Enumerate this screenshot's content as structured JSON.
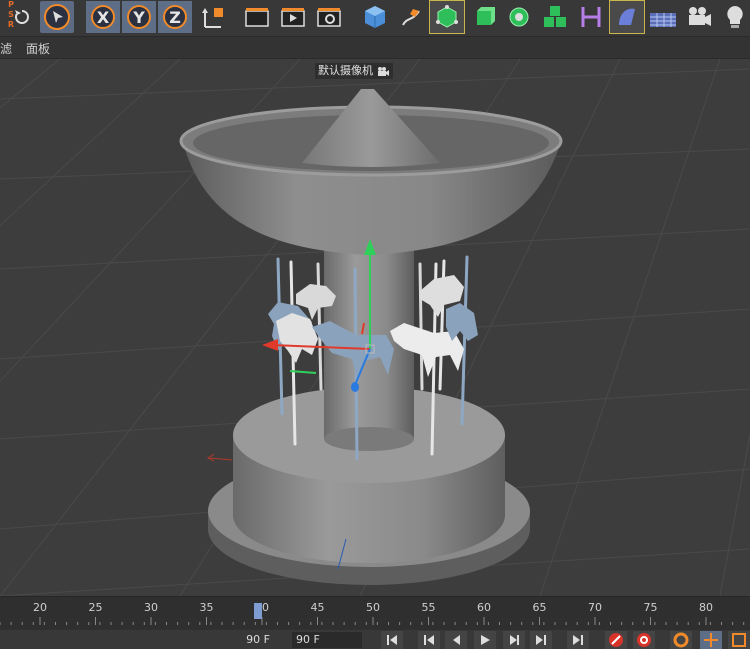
{
  "toolbar": {
    "psr_label": "PSR",
    "axis_x": "X",
    "axis_y": "Y",
    "axis_z": "Z",
    "accent": "#f08a2a",
    "selected_bg": "#5d6e86"
  },
  "menu": {
    "item_filter": "滤",
    "item_panel": "面板"
  },
  "viewport": {
    "camera_label": "默认摄像机",
    "camera_icon": "camera-icon"
  },
  "timeline": {
    "ticks": [
      "20",
      "25",
      "30",
      "35",
      "40",
      "45",
      "50",
      "55",
      "60",
      "65",
      "70",
      "75",
      "80"
    ],
    "current_frame": 40
  },
  "transport": {
    "end_frame_display": "90 F",
    "end_frame_input": "90 F"
  }
}
